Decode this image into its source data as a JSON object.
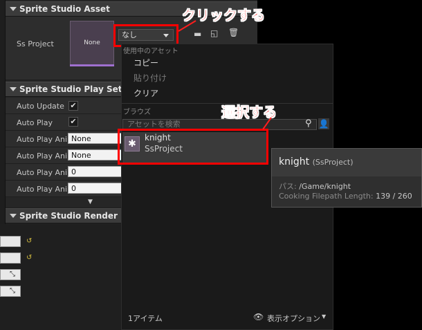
{
  "sections": {
    "asset": "Sprite Studio Asset",
    "play": "Sprite Studio Play Settings",
    "render": "Sprite Studio Render Settin"
  },
  "asset_row": {
    "label": "Ss Project",
    "thumbnail_text": "None",
    "combo_value": "なし"
  },
  "play_rows": [
    {
      "label": "Auto Update"
    },
    {
      "label": "Auto Play"
    },
    {
      "label": "Auto Play Anir",
      "value": "None"
    },
    {
      "label": "Auto Play Anir",
      "value": "None"
    },
    {
      "label": "Auto Play Anir",
      "value": "0"
    },
    {
      "label": "Auto Play Anir",
      "value": "0"
    }
  ],
  "menu": {
    "section_current": "使用中のアセット",
    "copy": "コピー",
    "paste": "貼り付け",
    "clear": "クリア",
    "section_browse": "ブラウズ",
    "search_placeholder": "アセットを検索",
    "asset_name": "knight",
    "asset_type": "SsProject",
    "item_count": "1アイテム",
    "view_options": "表示オプション"
  },
  "tooltip": {
    "title": "knight",
    "title_type": "(SsProject)",
    "path_label": "パス:",
    "path_value": "/Game/knight",
    "cook_label": "Cooking Filepath Length:",
    "cook_value": "139 / 260"
  },
  "annotations": {
    "click": "クリックする",
    "select": "選択する"
  },
  "colors": {
    "highlight": "#ff0000",
    "panel_bg": "#242424",
    "menu_bg": "#1a1a1a"
  }
}
